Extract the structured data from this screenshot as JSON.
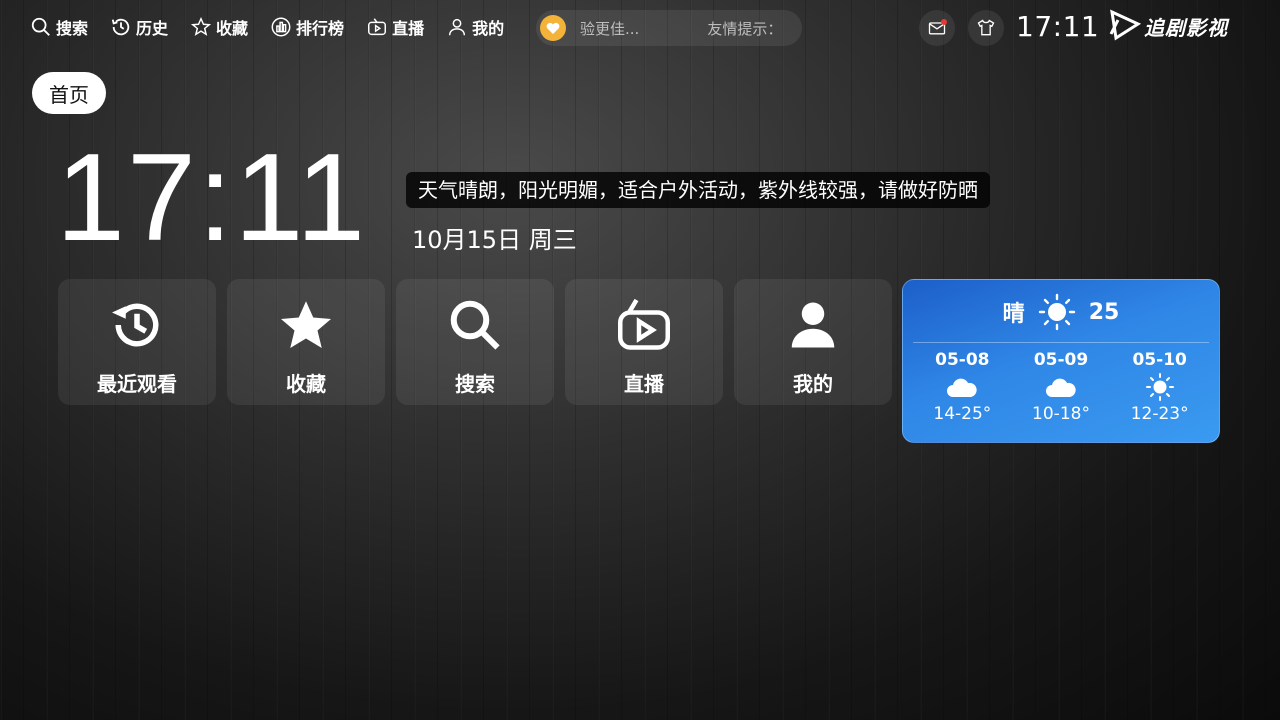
{
  "topbar": {
    "nav": [
      {
        "label": "搜索",
        "icon": "search-icon"
      },
      {
        "label": "历史",
        "icon": "history-icon"
      },
      {
        "label": "收藏",
        "icon": "star-icon"
      },
      {
        "label": "排行榜",
        "icon": "ranking-icon"
      },
      {
        "label": "直播",
        "icon": "tv-icon"
      },
      {
        "label": "我的",
        "icon": "user-icon"
      }
    ],
    "notice_text": "验更佳...",
    "notice_tip": "友情提示：",
    "clock": "17:11",
    "logo_text": "追剧影视"
  },
  "home_chip": "首页",
  "clock": {
    "time": "17:11",
    "weather_tip": "天气晴朗，阳光明媚，适合户外活动，紫外线较强，请做好防晒",
    "date": "10月15日 周三"
  },
  "tiles": [
    {
      "label": "最近观看",
      "icon": "history-icon"
    },
    {
      "label": "收藏",
      "icon": "star-icon"
    },
    {
      "label": "搜索",
      "icon": "search-icon"
    },
    {
      "label": "直播",
      "icon": "tv-icon"
    },
    {
      "label": "我的",
      "icon": "user-icon"
    }
  ],
  "weather": {
    "condition": "晴",
    "temperature": "25",
    "forecast": [
      {
        "date": "05-08",
        "icon": "cloud-icon",
        "range": "14-25°"
      },
      {
        "date": "05-09",
        "icon": "cloud-icon",
        "range": "10-18°"
      },
      {
        "date": "05-10",
        "icon": "sun-icon",
        "range": "12-23°"
      }
    ]
  },
  "colors": {
    "weather_card": "#2f86e6",
    "notice_badge": "#f3b23a",
    "mail_dot": "#e53935"
  }
}
